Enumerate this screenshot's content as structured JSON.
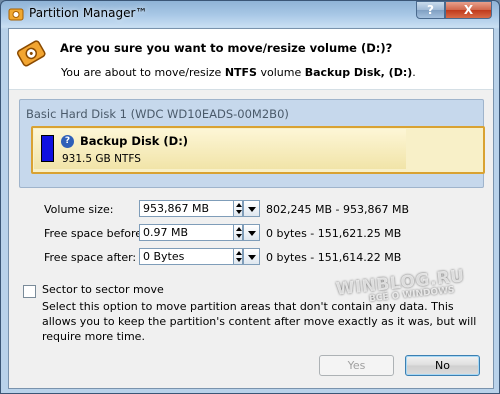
{
  "window": {
    "title": "Partition Manager™",
    "help_label": "?",
    "close_label": "X"
  },
  "header": {
    "question": "Are you sure you want to move/resize volume (D:)?",
    "sub_prefix": "You are about to move/resize ",
    "sub_fs": "NTFS",
    "sub_mid": " volume ",
    "sub_volume": "Backup Disk, (D:)",
    "sub_suffix": "."
  },
  "disk": {
    "label": "Basic Hard Disk 1 (WDC WD10EADS-00M2B0)",
    "partition_name": "Backup Disk (D:)",
    "partition_size": "931.5 GB NTFS",
    "partition_icon": "?",
    "partition_color": "#1010e0"
  },
  "fields": [
    {
      "label": "Volume size:",
      "value": "953,867 MB",
      "range": "802,245 MB - 953,867 MB"
    },
    {
      "label": "Free space before:",
      "value": "0.97 MB",
      "range": "0 bytes - 151,621.25 MB"
    },
    {
      "label": "Free space after:",
      "value": "0 Bytes",
      "range": "0 bytes - 151,614.22 MB"
    }
  ],
  "sector": {
    "label": "Sector to sector move",
    "checked": false,
    "description": "Select this option to move partition areas that don't contain any data. This allows you to keep the partition's content after move exactly as it was, but will require more time."
  },
  "buttons": {
    "yes": "Yes",
    "no": "No"
  },
  "watermark": {
    "main": "WINBLOG.RU",
    "sub": "ВСЁ О WINDOWS"
  }
}
